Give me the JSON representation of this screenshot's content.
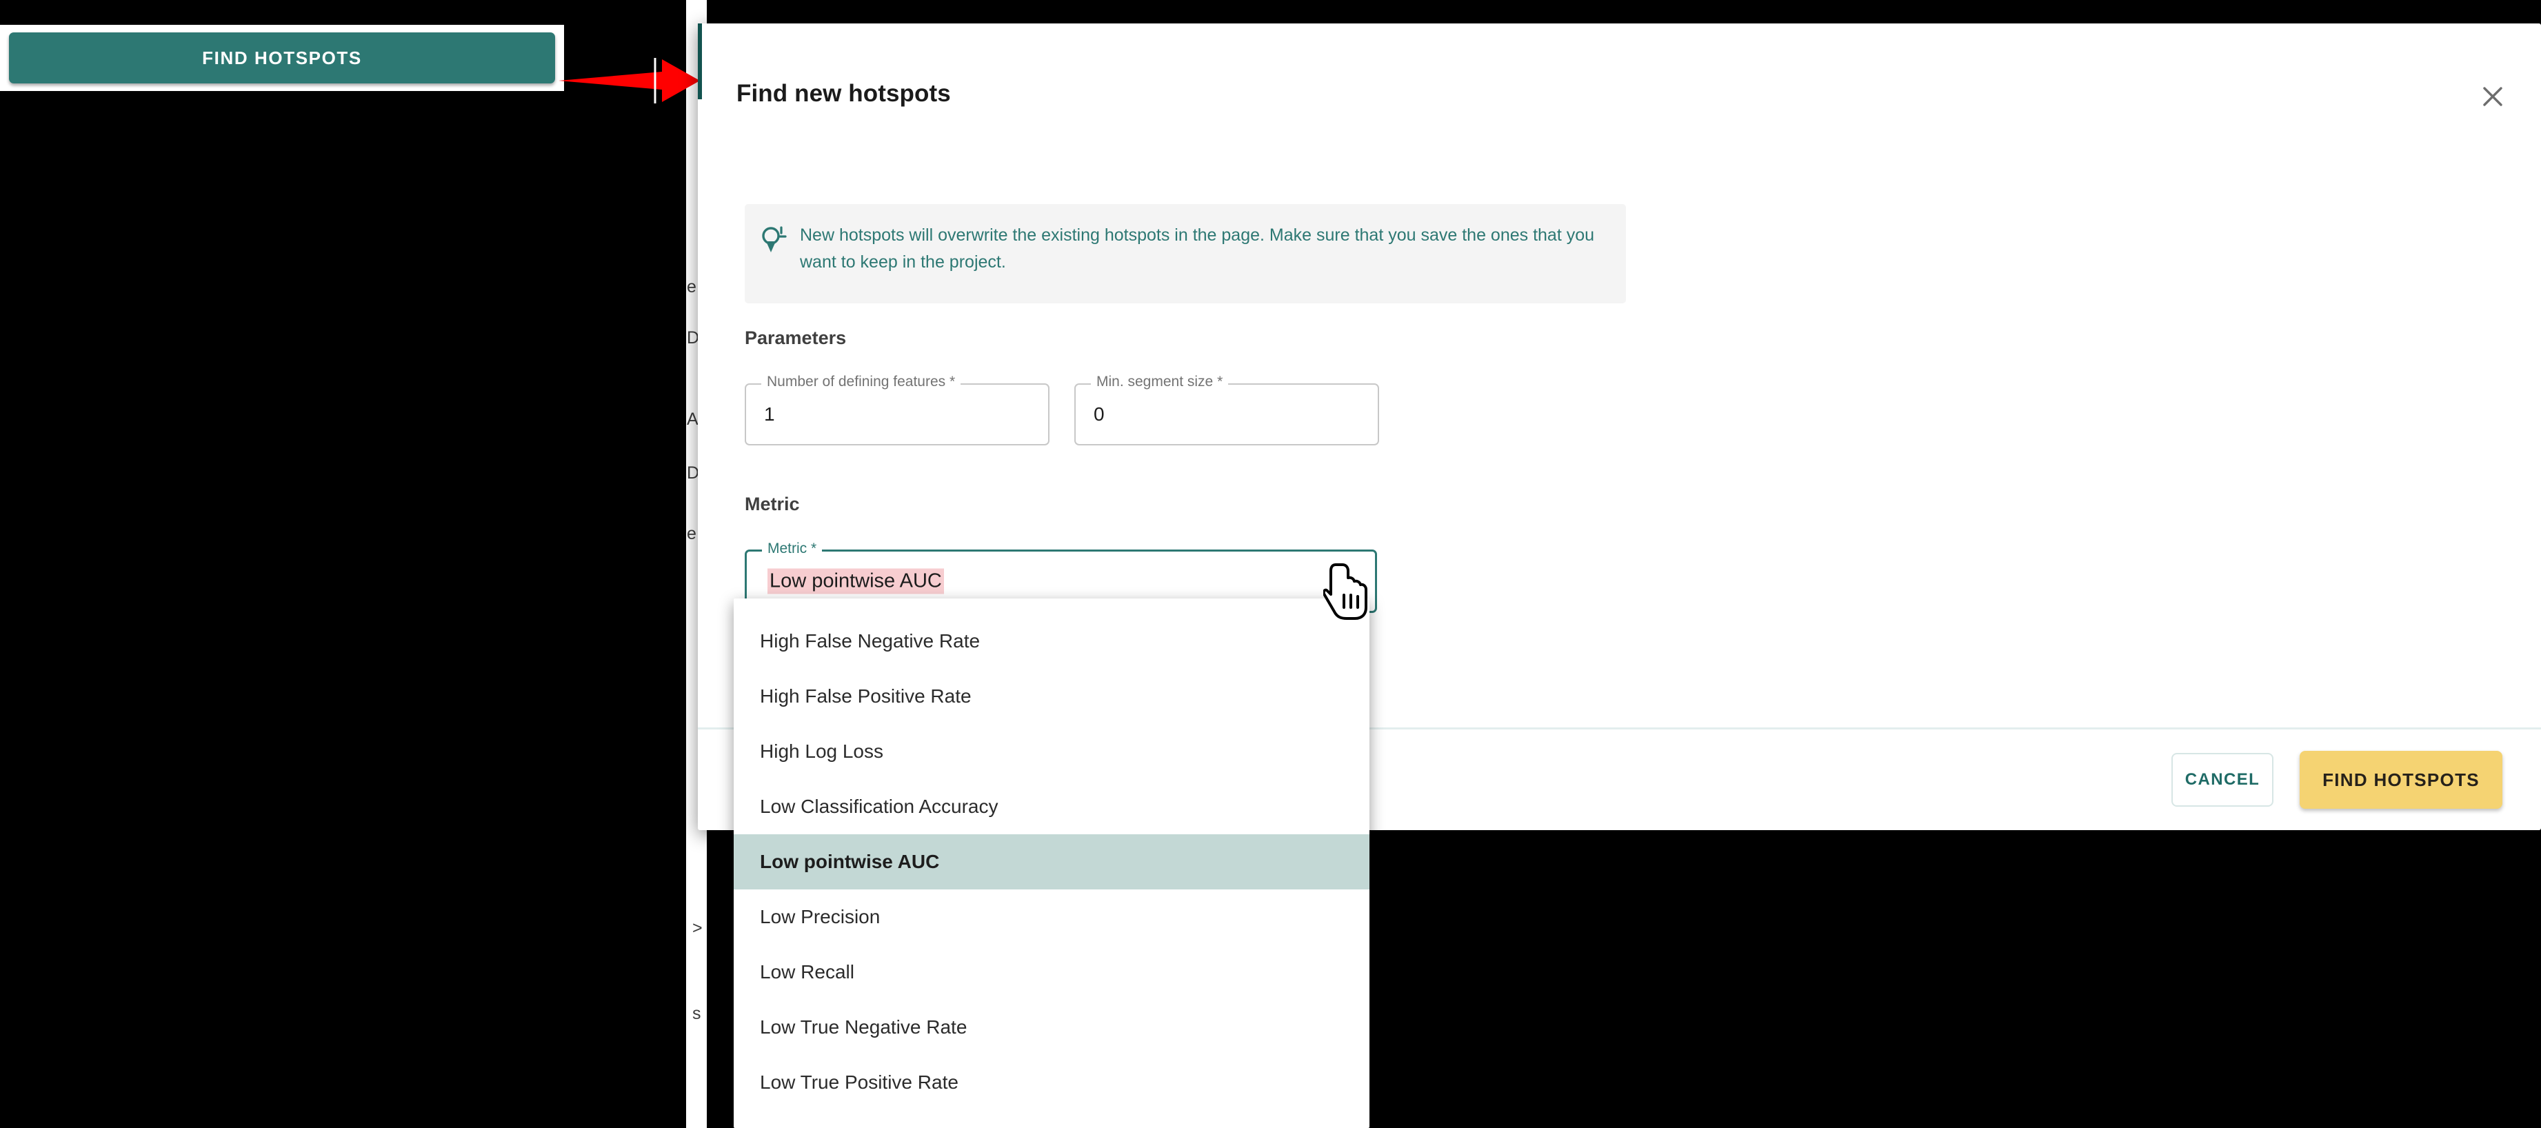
{
  "callout": {
    "button_label": "FIND HOTSPOTS",
    "arrow_color": "#ff0000",
    "button_color": "#2d7873"
  },
  "background": {
    "fragments": [
      "e",
      "D",
      "A",
      "D",
      "e",
      ">",
      "s"
    ]
  },
  "dialog": {
    "title": "Find new hotspots",
    "close_icon": "close-icon",
    "banner": {
      "icon": "lightbulb-idea-icon",
      "text": "New hotspots will overwrite the existing hotspots in the page. Make sure that you save the ones that you want to keep in the project.",
      "text_color": "#2d7873",
      "background_color": "#f4f4f4"
    },
    "sections": {
      "parameters_title": "Parameters",
      "metric_title": "Metric"
    },
    "fields": {
      "number_of_defining_features": {
        "label": "Number of defining features *",
        "value": "1"
      },
      "min_segment_size": {
        "label": "Min. segment size *",
        "value": "0"
      },
      "metric": {
        "label": "Metric *",
        "value": "Low pointwise AUC",
        "highlight_color": "#f7cdd0",
        "border_color": "#2d7873",
        "caret_icon": "caret-up-icon",
        "expanded": true
      }
    },
    "footer": {
      "cancel_label": "CANCEL",
      "submit_label": "FIND HOTSPOTS",
      "submit_color": "#f5d372"
    }
  },
  "dropdown": {
    "selected": "Low pointwise AUC",
    "selected_background": "#c3d8d5",
    "options": [
      "High False Negative Rate",
      "High False Positive Rate",
      "High Log Loss",
      "Low Classification Accuracy",
      "Low pointwise AUC",
      "Low Precision",
      "Low Recall",
      "Low True Negative Rate",
      "Low True Positive Rate"
    ]
  },
  "cursor": {
    "icon": "pointing-hand-cursor"
  }
}
